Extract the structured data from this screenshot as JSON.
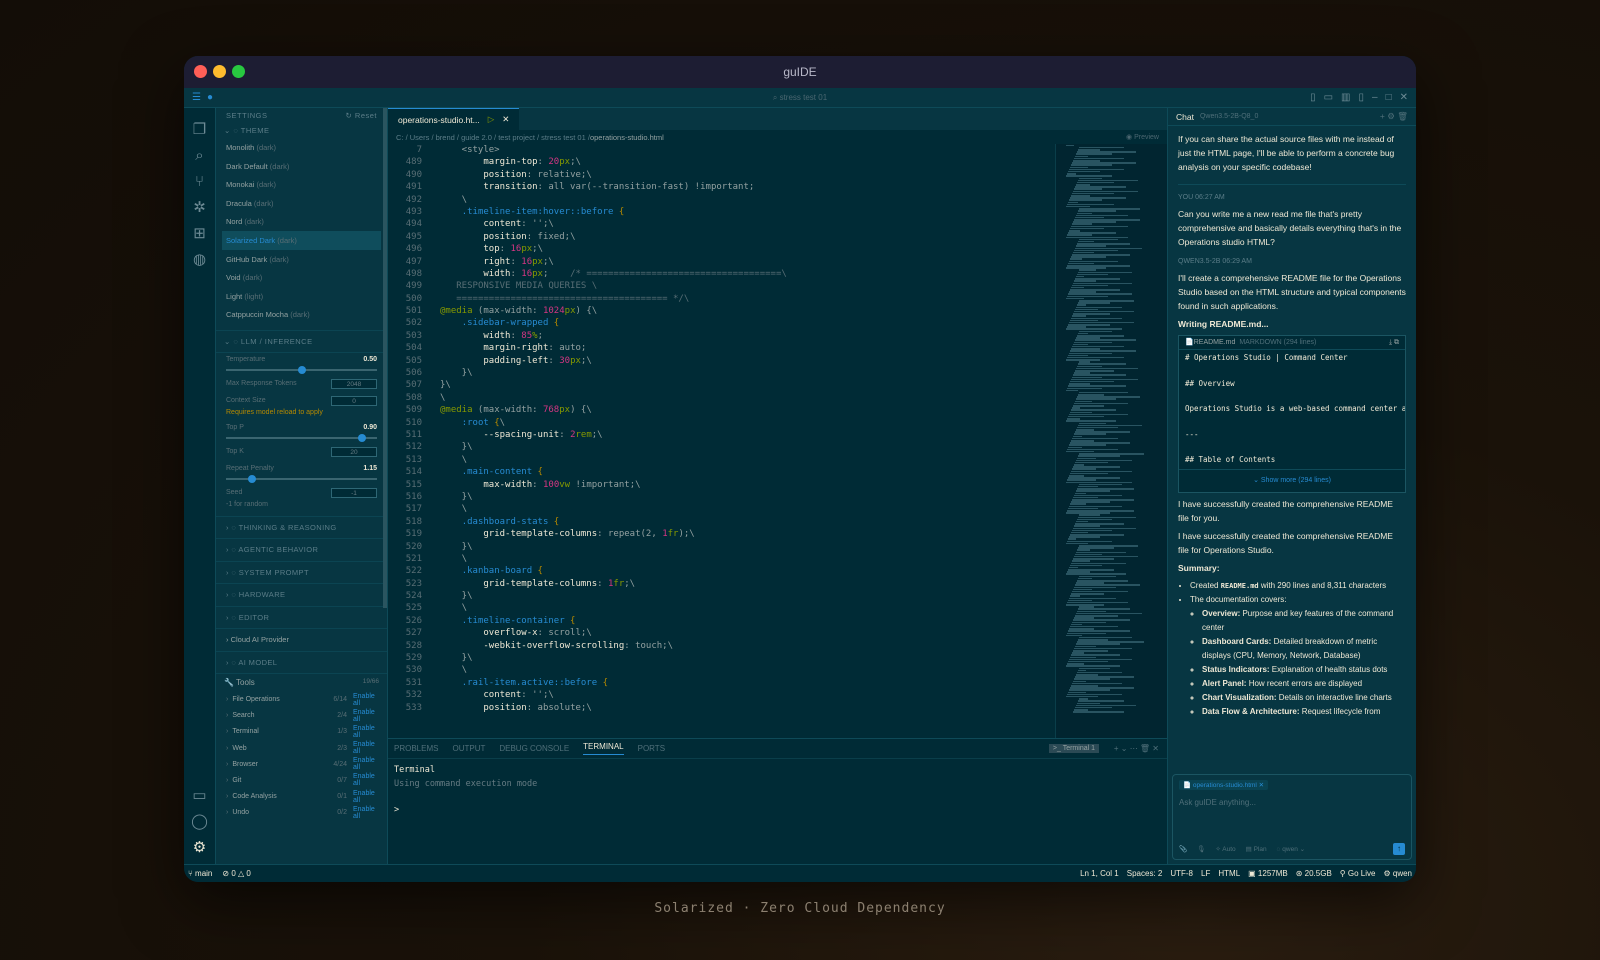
{
  "window": {
    "title": "guIDE",
    "search": "stress test 01"
  },
  "settings": {
    "header": "SETTINGS",
    "reset": "Reset",
    "theme_title": "THEME",
    "themes": [
      {
        "name": "Monolith",
        "tag": "(dark)"
      },
      {
        "name": "Dark Default",
        "tag": "(dark)"
      },
      {
        "name": "Monokai",
        "tag": "(dark)"
      },
      {
        "name": "Dracula",
        "tag": "(dark)"
      },
      {
        "name": "Nord",
        "tag": "(dark)"
      },
      {
        "name": "Solarized Dark",
        "tag": "(dark)"
      },
      {
        "name": "GitHub Dark",
        "tag": "(dark)"
      },
      {
        "name": "Void",
        "tag": "(dark)"
      },
      {
        "name": "Light",
        "tag": "(light)"
      },
      {
        "name": "Catppuccin Mocha",
        "tag": "(dark)"
      }
    ],
    "llm_title": "LLM / INFERENCE",
    "temperature_label": "Temperature",
    "temperature_value": "0.50",
    "temperature_fraction": 0.5,
    "max_tokens_label": "Max Response Tokens",
    "max_tokens_value": "2048",
    "context_label": "Context Size",
    "context_value": "0",
    "reload_warning": "Requires model reload to apply",
    "top_p_label": "Top P",
    "top_p_value": "0.90",
    "top_p_fraction": 0.9,
    "top_k_label": "Top K",
    "top_k_value": "20",
    "repeat_label": "Repeat Penalty",
    "repeat_value": "1.15",
    "repeat_fraction": 0.17,
    "seed_label": "Seed",
    "seed_value": "-1",
    "seed_hint": "-1 for random",
    "sections": [
      "THINKING & REASONING",
      "AGENTIC BEHAVIOR",
      "SYSTEM PROMPT",
      "HARDWARE",
      "EDITOR"
    ],
    "cloud": "Cloud AI Provider",
    "ai_model": "AI MODEL",
    "tools_title": "Tools",
    "tools_count": "19/66",
    "tools": [
      {
        "name": "File Operations",
        "count": "6/14",
        "action": "Enable all"
      },
      {
        "name": "Search",
        "count": "2/4",
        "action": "Enable all"
      },
      {
        "name": "Terminal",
        "count": "1/3",
        "action": "Enable all"
      },
      {
        "name": "Web",
        "count": "2/3",
        "action": "Enable all"
      },
      {
        "name": "Browser",
        "count": "4/24",
        "action": "Enable all"
      },
      {
        "name": "Git",
        "count": "0/7",
        "action": "Enable all"
      },
      {
        "name": "Code Analysis",
        "count": "0/1",
        "action": "Enable all"
      },
      {
        "name": "Undo",
        "count": "0/2",
        "action": "Enable all"
      }
    ]
  },
  "editor": {
    "tab": "operations-studio.ht...",
    "breadcrumb": [
      "C:",
      "Users",
      "brend",
      "guide 2.0",
      "test project",
      "stress test 01"
    ],
    "breadcrumb_file": "operations-studio.html",
    "preview": "Preview",
    "lines": [
      {
        "n": "7",
        "t": "    <style>"
      },
      {
        "n": "489",
        "t": "        margin-top: 20px;\\"
      },
      {
        "n": "490",
        "t": "        position: relative;\\"
      },
      {
        "n": "491",
        "t": "        transition: all var(--transition-fast) !important;"
      },
      {
        "n": "492",
        "t": "    \\"
      },
      {
        "n": "493",
        "t": "    .timeline-item:hover::before {"
      },
      {
        "n": "494",
        "t": "        content: '';\\"
      },
      {
        "n": "495",
        "t": "        position: fixed;\\"
      },
      {
        "n": "496",
        "t": "        top: 16px;\\"
      },
      {
        "n": "497",
        "t": "        right: 16px;\\"
      },
      {
        "n": "498",
        "t": "        width: 16px;    /* ====================================\\"
      },
      {
        "n": "499",
        "t": "   RESPONSIVE MEDIA QUERIES \\"
      },
      {
        "n": "500",
        "t": "   ======================================= */\\"
      },
      {
        "n": "501",
        "t": "@media (max-width: 1024px) {\\"
      },
      {
        "n": "502",
        "t": "    .sidebar-wrapped {"
      },
      {
        "n": "503",
        "t": "        width: 85%;"
      },
      {
        "n": "504",
        "t": "        margin-right: auto;"
      },
      {
        "n": "505",
        "t": "        padding-left: 30px;\\"
      },
      {
        "n": "506",
        "t": "    }\\"
      },
      {
        "n": "507",
        "t": "}\\"
      },
      {
        "n": "508",
        "t": "\\"
      },
      {
        "n": "509",
        "t": "@media (max-width: 768px) {\\"
      },
      {
        "n": "510",
        "t": "    :root {\\"
      },
      {
        "n": "511",
        "t": "        --spacing-unit: 2rem;\\"
      },
      {
        "n": "512",
        "t": "    }\\"
      },
      {
        "n": "513",
        "t": "    \\"
      },
      {
        "n": "514",
        "t": "    .main-content {"
      },
      {
        "n": "515",
        "t": "        max-width: 100vw !important;\\"
      },
      {
        "n": "516",
        "t": "    }\\"
      },
      {
        "n": "517",
        "t": "    \\"
      },
      {
        "n": "518",
        "t": "    .dashboard-stats {"
      },
      {
        "n": "519",
        "t": "        grid-template-columns: repeat(2, 1fr);\\"
      },
      {
        "n": "520",
        "t": "    }\\"
      },
      {
        "n": "521",
        "t": "    \\"
      },
      {
        "n": "522",
        "t": "    .kanban-board {"
      },
      {
        "n": "523",
        "t": "        grid-template-columns: 1fr;\\"
      },
      {
        "n": "524",
        "t": "    }\\"
      },
      {
        "n": "525",
        "t": "    \\"
      },
      {
        "n": "526",
        "t": "    .timeline-container {"
      },
      {
        "n": "527",
        "t": "        overflow-x: scroll;\\"
      },
      {
        "n": "528",
        "t": "        -webkit-overflow-scrolling: touch;\\"
      },
      {
        "n": "529",
        "t": "    }\\"
      },
      {
        "n": "530",
        "t": "    \\"
      },
      {
        "n": "531",
        "t": "    .rail-item.active::before {"
      },
      {
        "n": "532",
        "t": "        content: '';\\"
      },
      {
        "n": "533",
        "t": "        position: absolute;\\"
      }
    ]
  },
  "panel": {
    "tabs": [
      "PROBLEMS",
      "OUTPUT",
      "DEBUG CONSOLE",
      "TERMINAL",
      "PORTS"
    ],
    "terminal_badge": "Terminal 1",
    "term_title": "Terminal",
    "term_line": "Using command execution mode",
    "prompt": ">"
  },
  "chat": {
    "title": "Chat",
    "model": "Qwen3.5-2B-Q8_0",
    "intro": "If you can share the actual source files with me instead of just the HTML page, I'll be able to perform a concrete bug analysis on your specific codebase!",
    "you": "YOU",
    "you_time": "06:27 AM",
    "user_msg": "Can you write me a new read me file that's pretty comprehensive and basically details everything that's in the Operations studio HTML?",
    "bot": "QWEN3.5-2B",
    "bot_time": "06:29 AM",
    "bot_msg": "I'll create a comprehensive README file for the Operations Studio based on the HTML structure and typical components found in such applications.",
    "writing": "Writing README.md...",
    "readme_name": "README.md",
    "readme_meta": "MARKDOWN (294 lines)",
    "readme_lines": [
      "# Operations Studio | Command Center",
      "",
      "## Overview",
      "",
      "Operations Studio is a web-based command center ap",
      "",
      "---",
      "",
      "## Table of Contents"
    ],
    "show_more": "Show more (294 lines)",
    "done1": "I have successfully created the comprehensive README file for you.",
    "done2": "I have successfully created the comprehensive README file for Operations Studio.",
    "summary": "Summary:",
    "created_pre": "Created ",
    "created_file": "README.md",
    "created_post": " with 290 lines and 8,311 characters",
    "covers": "The documentation covers:",
    "items": [
      {
        "b": "Overview:",
        "t": " Purpose and key features of the command center"
      },
      {
        "b": "Dashboard Cards:",
        "t": " Detailed breakdown of metric displays (CPU, Memory, Network, Database)"
      },
      {
        "b": "Status Indicators:",
        "t": " Explanation of health status dots"
      },
      {
        "b": "Alert Panel:",
        "t": " How recent errors are displayed"
      },
      {
        "b": "Chart Visualization:",
        "t": " Details on interactive line charts"
      },
      {
        "b": "Data Flow & Architecture:",
        "t": " Request lifecycle from"
      }
    ],
    "chip": "operations-studio.html",
    "placeholder": "Ask guIDE anything...",
    "auto": "Auto",
    "plan": "Plan",
    "model_short": "qwen"
  },
  "status": {
    "branch": "main",
    "errors": "0",
    "warnings": "0",
    "pos": "Ln 1, Col 1",
    "spaces": "Spaces: 2",
    "enc": "UTF-8",
    "eol": "LF",
    "lang": "HTML",
    "mem": "1257MB",
    "disk": "20.5GB",
    "live": "Go Live",
    "model": "qwen"
  },
  "caption": "Solarized · Zero Cloud Dependency"
}
